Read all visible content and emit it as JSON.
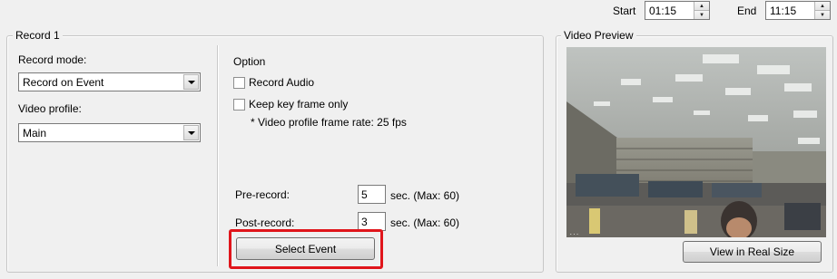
{
  "schedule": {
    "start_label": "Start",
    "start_value": "01:15",
    "end_label": "End",
    "end_value": "11:15"
  },
  "record_group": {
    "title": "Record 1",
    "record_mode_label": "Record mode:",
    "record_mode_value": "Record on Event",
    "video_profile_label": "Video profile:",
    "video_profile_value": "Main",
    "option_title": "Option",
    "record_audio_label": "Record Audio",
    "record_audio_checked": false,
    "keyframe_label": "Keep key frame only",
    "keyframe_checked": false,
    "frame_rate_note": "* Video profile frame rate: 25 fps",
    "pre_record_label": "Pre-record:",
    "pre_record_value": "5",
    "pre_record_unit": "sec.  (Max: 60)",
    "post_record_label": "Post-record:",
    "post_record_value": "3",
    "post_record_unit": "sec.  (Max: 60)",
    "select_event_label": "Select Event",
    "highlight_color": "#e0151b"
  },
  "preview_group": {
    "title": "Video Preview",
    "view_real_size_label": "View in Real Size"
  }
}
